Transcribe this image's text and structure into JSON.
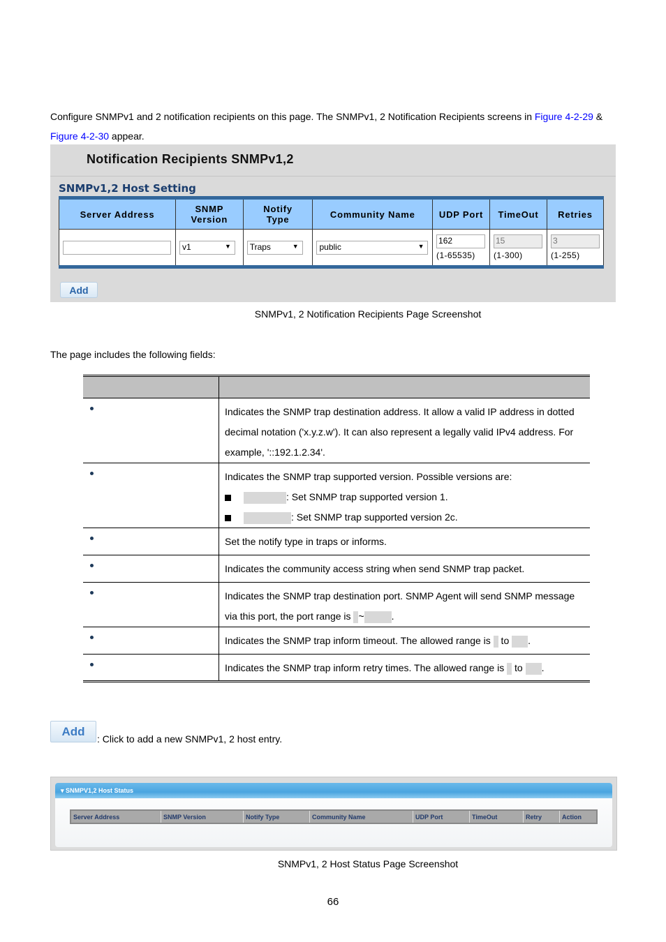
{
  "intro": {
    "text1": "Configure SNMPv1 and 2 notification recipients on this page. The SNMPv1, 2 Notification Recipients screens in ",
    "link1": "Figure 4-2-29",
    "amp": " &",
    "link2": "Figure 4-2-30",
    "text2": " appear."
  },
  "shot1": {
    "title": "Notification Recipients SNMPv1,2",
    "subtitle": "SNMPv1,2 Host Setting",
    "headers": [
      "Server Address",
      "SNMP Version",
      "Notify Type",
      "Community Name",
      "UDP Port",
      "TimeOut",
      "Retries"
    ],
    "server_address": "",
    "snmp_version": "v1",
    "notify_type": "Traps",
    "community_name": "public",
    "udp_port": "162",
    "udp_range": "(1-65535)",
    "timeout": "15",
    "timeout_range": "(1-300)",
    "retries": "3",
    "retries_range": "(1-255)",
    "add_label": "Add",
    "caption": "SNMPv1, 2 Notification Recipients Page Screenshot"
  },
  "fields_intro": "The page includes the following fields:",
  "fields": [
    {
      "desc": "Indicates the SNMP trap destination address. It allow a valid IP address in dotted decimal notation ('x.y.z.w'). It can also represent a legally valid IPv4 address. For example, '::192.1.2.34'."
    },
    {
      "desc": "Indicates the SNMP trap supported version. Possible versions are:",
      "opt1": ": Set SNMP trap supported version 1.",
      "opt2": ": Set SNMP trap supported version 2c."
    },
    {
      "desc": "Set the notify type in traps or informs."
    },
    {
      "desc": "Indicates the community access string when send SNMP trap packet."
    },
    {
      "desc": "Indicates the SNMP trap destination port. SNMP Agent will send SNMP message via this port, the port range is ",
      "sep": "~",
      "end": "."
    },
    {
      "desc": "Indicates the SNMP trap inform timeout. The allowed range is ",
      "to": " to ",
      "end": "."
    },
    {
      "desc": "Indicates the SNMP trap inform retry times. The allowed range is ",
      "to": " to ",
      "end": "."
    }
  ],
  "add_note": {
    "button": "Add",
    "text": ": Click to add a new SNMPv1, 2 host entry."
  },
  "shot2": {
    "bar_title": "SNMPV1,2 Host Status",
    "headers": [
      "Server Address",
      "SNMP Version",
      "Notify Type",
      "Community Name",
      "UDP Port",
      "TimeOut",
      "Retry",
      "Action"
    ],
    "caption": "SNMPv1, 2 Host Status Page Screenshot"
  },
  "page_number": "66"
}
